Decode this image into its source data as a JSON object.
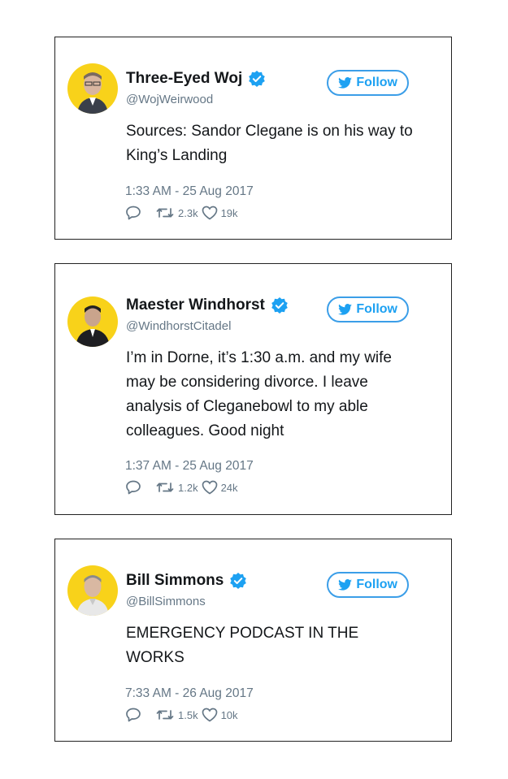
{
  "colors": {
    "accent": "#1da1f2",
    "avatar_bg": "#f8d21a",
    "muted": "#657786"
  },
  "tweets": [
    {
      "name": "Three-Eyed Woj",
      "handle": "@WojWeirwood",
      "follow_label": "Follow",
      "text": "Sources: Sandor Clegane is on his way to King’s Landing",
      "timestamp": "1:33 AM - 25 Aug 2017",
      "retweets": "2.3k",
      "likes": "19k",
      "icons": [
        "verified-badge-icon",
        "twitter-bird-icon",
        "reply-icon",
        "retweet-icon",
        "heart-icon"
      ]
    },
    {
      "name": "Maester Windhorst",
      "handle": "@WindhorstCitadel",
      "follow_label": "Follow",
      "text": "I’m in Dorne, it’s 1:30 a.m. and my wife may be considering divorce. I leave analysis of Cleganebowl to my able colleagues. Good night",
      "timestamp": "1:37 AM - 25 Aug 2017",
      "retweets": "1.2k",
      "likes": "24k",
      "icons": [
        "verified-badge-icon",
        "twitter-bird-icon",
        "reply-icon",
        "retweet-icon",
        "heart-icon"
      ]
    },
    {
      "name": "Bill Simmons",
      "handle": "@BillSimmons",
      "follow_label": "Follow",
      "text": "EMERGENCY PODCAST IN THE WORKS",
      "timestamp": "7:33 AM - 26 Aug 2017",
      "retweets": "1.5k",
      "likes": "10k",
      "icons": [
        "verified-badge-icon",
        "twitter-bird-icon",
        "reply-icon",
        "retweet-icon",
        "heart-icon"
      ]
    }
  ]
}
